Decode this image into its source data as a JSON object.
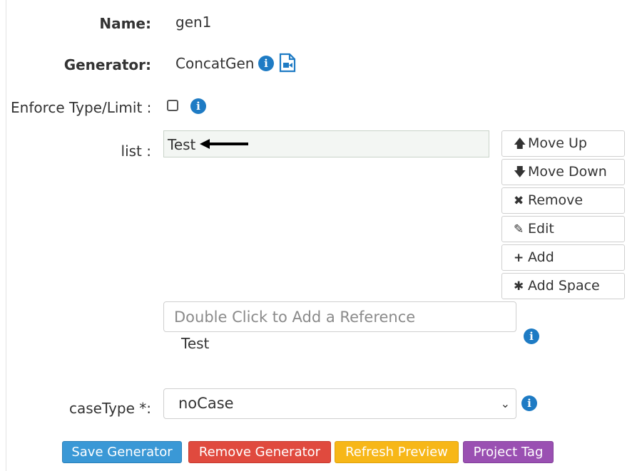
{
  "form": {
    "name": {
      "label": "Name:",
      "value": "gen1"
    },
    "generator": {
      "label": "Generator:",
      "value": "ConcatGen"
    },
    "enforce": {
      "label": "Enforce Type/Limit :",
      "checked": false
    },
    "list": {
      "label": "list :",
      "items": [
        "Test"
      ]
    },
    "reference": {
      "placeholder": "Double Click to Add a Reference",
      "preview": "Test"
    },
    "case_type": {
      "label": "caseType *:",
      "selected": "noCase"
    }
  },
  "list_buttons": {
    "move_up": "Move Up",
    "move_down": "Move Down",
    "remove": "Remove",
    "edit": "Edit",
    "add": "Add",
    "add_space": "Add Space"
  },
  "actions": {
    "save": "Save Generator",
    "remove": "Remove Generator",
    "refresh": "Refresh Preview",
    "project_tag": "Project Tag"
  },
  "colors": {
    "info": "#1e7bc4",
    "save": "#3a98d6",
    "remove": "#e04a3e",
    "refresh": "#f7b718",
    "project_tag": "#9a50b2"
  },
  "icons": [
    "info-icon",
    "video-file-icon",
    "arrow-up-icon",
    "arrow-down-icon",
    "times-icon",
    "pencil-icon",
    "plus-icon",
    "asterisk-icon",
    "chevron-down-icon"
  ]
}
